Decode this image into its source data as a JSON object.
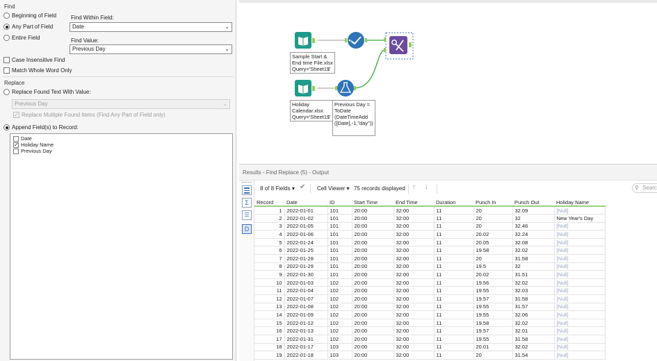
{
  "find": {
    "section_label": "Find",
    "options": [
      "Beginning of Field",
      "Any Part of Field",
      "Entire Field"
    ],
    "selected_option": "Any Part of Field",
    "within_field_label": "Find Within Field:",
    "within_field_value": "Date",
    "find_value_label": "Find Value:",
    "find_value_value": "Previous Day",
    "case_insensitive_label": "Case Insensitive Find",
    "whole_word_label": "Match Whole Word Only"
  },
  "replace": {
    "section_label": "Replace",
    "replace_text_label": "Replace Found Text With Value:",
    "replace_value": "Previous Day",
    "replace_multiple_label": "Replace Multiple Found Items (Find Any Part of Field only)",
    "append_label": "Append Field(s) to Record:",
    "append_fields": [
      {
        "name": "Date",
        "checked": false
      },
      {
        "name": "Holiday Name",
        "checked": true
      },
      {
        "name": "Previous Day",
        "checked": false
      }
    ]
  },
  "canvas": {
    "tools": {
      "input1_label": "Sample Start &\nEnd time File.xlsx\nQuery='Sheet1$'",
      "input2_label": "Holiday\nCalendar.xlsx\nQuery='Sheet1$'",
      "formula_label": "Previous Day =\nToDate\n(DateTimeAdd\n([Date],-1,\"day\"))"
    },
    "colors": {
      "input": "#1f9a8a",
      "select": "#2d74b8",
      "formula": "#2d74b8",
      "find_replace": "#6c4a9e",
      "connector": "#3aa63a",
      "anchor": "#8fd14f"
    }
  },
  "results": {
    "title": "Results - Find Replace (5) - Output",
    "fields_selector": "8 of 8 Fields",
    "cell_viewer": "Cell Viewer",
    "records_displayed": "75 records displayed",
    "search_placeholder": "Search",
    "columns": [
      "Record",
      "Date",
      "ID",
      "Start Time",
      "End Time",
      "Duration",
      "Punch In",
      "Punch Out",
      "Holiday Name"
    ],
    "rows": [
      [
        "1",
        "2022-01-01",
        "101",
        "20:00",
        "32:00",
        "11",
        "20",
        "32.09",
        "[Null]"
      ],
      [
        "2",
        "2022-01-02",
        "101",
        "20:00",
        "32:00",
        "11",
        "20",
        "32",
        "New Year's Day"
      ],
      [
        "3",
        "2022-01-05",
        "101",
        "20:00",
        "32:00",
        "11",
        "20",
        "32.46",
        "[Null]"
      ],
      [
        "4",
        "2022-01-06",
        "101",
        "20:00",
        "32:00",
        "11",
        "20.02",
        "32.24",
        "[Null]"
      ],
      [
        "5",
        "2022-01-24",
        "101",
        "20:00",
        "32:00",
        "11",
        "20.05",
        "32.08",
        "[Null]"
      ],
      [
        "6",
        "2022-01-25",
        "101",
        "20:00",
        "32:00",
        "11",
        "19.58",
        "32.02",
        "[Null]"
      ],
      [
        "7",
        "2022-01-28",
        "101",
        "20:00",
        "32:00",
        "11",
        "20",
        "31.58",
        "[Null]"
      ],
      [
        "8",
        "2022-01-29",
        "101",
        "20:00",
        "32:00",
        "11",
        "19.5",
        "32",
        "[Null]"
      ],
      [
        "9",
        "2022-01-30",
        "101",
        "20:00",
        "32:00",
        "11",
        "20.02",
        "31.51",
        "[Null]"
      ],
      [
        "10",
        "2022-01-03",
        "102",
        "20:00",
        "32:00",
        "11",
        "19.56",
        "32.02",
        "[Null]"
      ],
      [
        "11",
        "2022-01-04",
        "102",
        "20:00",
        "32:00",
        "11",
        "19.55",
        "32.03",
        "[Null]"
      ],
      [
        "12",
        "2022-01-07",
        "102",
        "20:00",
        "32:00",
        "11",
        "19.57",
        "31.58",
        "[Null]"
      ],
      [
        "13",
        "2022-01-08",
        "102",
        "20:00",
        "32:00",
        "11",
        "19.55",
        "31.57",
        "[Null]"
      ],
      [
        "14",
        "2022-01-09",
        "102",
        "20:00",
        "32:00",
        "11",
        "19.55",
        "32.06",
        "[Null]"
      ],
      [
        "15",
        "2022-01-12",
        "102",
        "20:00",
        "32:00",
        "11",
        "19.58",
        "32.02",
        "[Null]"
      ],
      [
        "16",
        "2022-01-13",
        "102",
        "20:00",
        "32:00",
        "11",
        "19.57",
        "32.01",
        "[Null]"
      ],
      [
        "17",
        "2022-01-31",
        "102",
        "20:00",
        "32:00",
        "11",
        "19.55",
        "31.58",
        "[Null]"
      ],
      [
        "18",
        "2022-01-17",
        "103",
        "20:00",
        "32:00",
        "11",
        "20.01",
        "32.02",
        "[Null]"
      ],
      [
        "19",
        "2022-01-18",
        "103",
        "20:00",
        "32:00",
        "11",
        "20",
        "31.54",
        "[Null]"
      ]
    ]
  }
}
